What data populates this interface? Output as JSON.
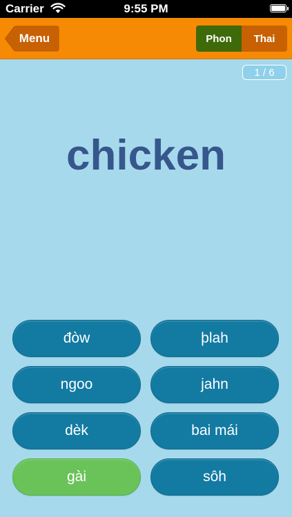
{
  "status_bar": {
    "carrier": "Carrier",
    "time": "9:55 PM"
  },
  "nav": {
    "menu_label": "Menu",
    "segments": [
      {
        "label": "Phon",
        "selected": true
      },
      {
        "label": "Thai",
        "selected": false
      }
    ]
  },
  "quiz": {
    "counter": "1 / 6",
    "prompt": "chicken",
    "answers": [
      {
        "label": "đòw",
        "state": "default"
      },
      {
        "label": "þlah",
        "state": "default"
      },
      {
        "label": "ngoo",
        "state": "default"
      },
      {
        "label": "jahn",
        "state": "default"
      },
      {
        "label": "dèk",
        "state": "default"
      },
      {
        "label": "bai mái",
        "state": "default"
      },
      {
        "label": "gài",
        "state": "correct"
      },
      {
        "label": "sôh",
        "state": "default"
      }
    ]
  },
  "colors": {
    "background": "#a6d9ec",
    "navbar": "#f78a04",
    "segment_active": "#3e6a0a",
    "segment_inactive": "#c86103",
    "answer_default": "#137aa2",
    "answer_correct": "#69c359",
    "prompt_text": "#36578c"
  }
}
